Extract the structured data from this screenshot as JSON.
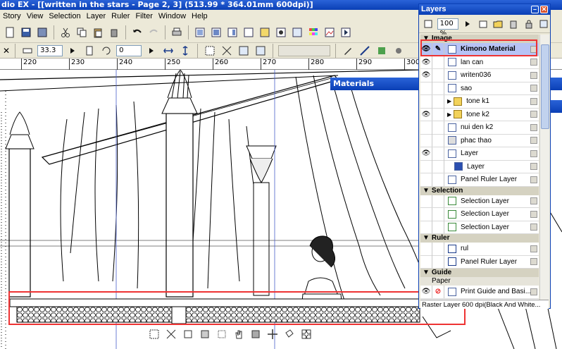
{
  "window": {
    "title": "dio EX - [[written in the stars - Page 2, 3] (513.99 * 364.01mm 600dpi)]"
  },
  "menu": [
    "Story",
    "View",
    "Selection",
    "Layer",
    "Ruler",
    "Filter",
    "Window",
    "Help"
  ],
  "toolbar2": {
    "zoom_value": "33.3",
    "angle_value": "0"
  },
  "ruler": {
    "ticks": [
      "220",
      "230",
      "240",
      "250",
      "260",
      "270",
      "280",
      "290",
      "300"
    ]
  },
  "materials": {
    "title": "Materials"
  },
  "layers_panel": {
    "title": "Layers",
    "zoom": "100 %",
    "sections": {
      "image": "Image",
      "selection": "Selection",
      "ruler": "Ruler",
      "guide": "Guide",
      "paper": "Paper"
    },
    "image_layers": [
      {
        "name": "Kimono Material",
        "selected": true,
        "visible": true
      },
      {
        "name": "lan can",
        "visible": true
      },
      {
        "name": "writen036",
        "visible": true
      },
      {
        "name": "sao",
        "visible": false
      },
      {
        "name": "tone k1",
        "visible": false,
        "folder": true
      },
      {
        "name": "tone k2",
        "visible": true,
        "folder": true
      },
      {
        "name": "nui den k2",
        "visible": false
      },
      {
        "name": "phac thao",
        "visible": false
      },
      {
        "name": "Layer",
        "visible": true
      },
      {
        "name": "Layer",
        "visible": false,
        "indent": true
      },
      {
        "name": "Panel Ruler Layer",
        "visible": false
      }
    ],
    "selection_layers": [
      "Selection Layer",
      "Selection Layer",
      "Selection Layer"
    ],
    "ruler_layers": [
      "rul",
      "Panel Ruler Layer"
    ],
    "paper_layers": [
      "Print Guide and Basi..."
    ],
    "status": "Raster Layer 600 dpi(Black And White..."
  },
  "colors": {
    "title_blue": "#0a3fb5",
    "highlight_red": "#e33333",
    "selected_row": "#b7c3f5"
  }
}
